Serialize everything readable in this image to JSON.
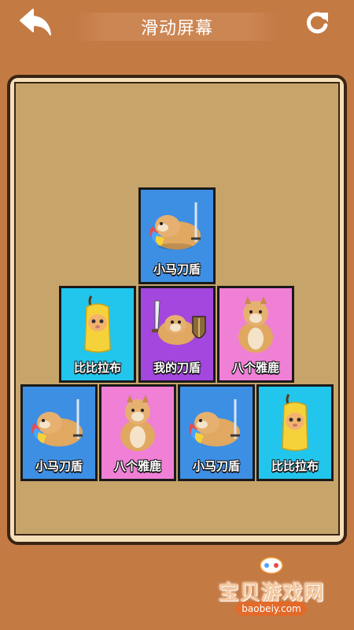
{
  "header": {
    "title": "滑动屏幕",
    "back_icon": "back-arrow-icon",
    "refresh_icon": "refresh-icon"
  },
  "colors": {
    "background": "#c47a43",
    "board_frame": "#f6dfb8",
    "board_inner": "#c7a46a",
    "card_blue": "#3d8fe4",
    "card_cyan": "#22c6ec",
    "card_purple": "#a347de",
    "card_pink": "#f07fd6"
  },
  "cards": [
    {
      "label": "小马刀盾",
      "color": "blue",
      "art": "doge-pony-knight"
    },
    {
      "label": "比比拉布",
      "color": "cyan",
      "art": "banana-cat"
    },
    {
      "label": "我的刀盾",
      "color": "purple",
      "art": "doge-sword-shield"
    },
    {
      "label": "八个雅鹿",
      "color": "pink",
      "art": "sitting-doge"
    },
    {
      "label": "小马刀盾",
      "color": "blue",
      "art": "doge-pony-knight"
    },
    {
      "label": "八个雅鹿",
      "color": "pink",
      "art": "sitting-doge"
    },
    {
      "label": "小马刀盾",
      "color": "blue",
      "art": "doge-pony-knight"
    },
    {
      "label": "比比拉布",
      "color": "cyan",
      "art": "banana-cat"
    }
  ],
  "watermark": {
    "name": "宝贝游戏网",
    "url": "baobeiy.com"
  }
}
